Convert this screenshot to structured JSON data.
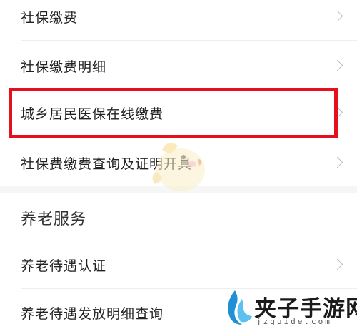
{
  "list_items": [
    {
      "label": "社保缴费"
    },
    {
      "label": "社保缴费明细"
    },
    {
      "label": "城乡居民医保在线缴费"
    },
    {
      "label": "社保费缴费查询及证明开具"
    }
  ],
  "pension_section": {
    "title": "养老服务",
    "items": [
      {
        "label": "养老待遇认证"
      },
      {
        "label": "养老待遇发放明细查询"
      }
    ]
  },
  "highlight_color": "#e4101d",
  "watermark": {
    "text": "夹子手游网",
    "url": "jzguide.com"
  },
  "icons": {
    "chevron": "chevron-right-icon",
    "mascot": "bird-mascot-icon",
    "logo": "wave-logo-icon"
  }
}
